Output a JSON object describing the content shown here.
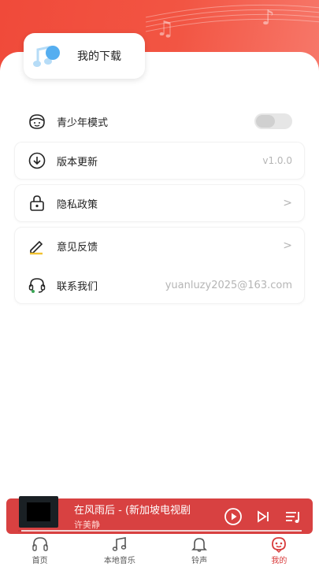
{
  "downloads": {
    "label": "我的下载"
  },
  "settings": {
    "youth_mode": {
      "label": "青少年模式",
      "enabled": false
    },
    "version": {
      "label": "版本更新",
      "value": "v1.0.0"
    },
    "privacy": {
      "label": "隐私政策",
      "chevron": ">"
    },
    "feedback": {
      "label": "意见反馈",
      "chevron": ">"
    },
    "contact": {
      "label": "联系我们",
      "value": "yuanluzy2025@163.com"
    }
  },
  "player": {
    "title": "在风雨后 - (新加坡电视剧",
    "artist": "许美静",
    "progress": 0.01
  },
  "tabs": [
    {
      "label": "首页",
      "icon": "headphones-icon",
      "active": false
    },
    {
      "label": "本地音乐",
      "icon": "music-note-icon",
      "active": false
    },
    {
      "label": "铃声",
      "icon": "bell-icon",
      "active": false
    },
    {
      "label": "我的",
      "icon": "profile-icon",
      "active": true
    }
  ],
  "colors": {
    "accent": "#d83a3a",
    "header": "#f04a3a"
  }
}
